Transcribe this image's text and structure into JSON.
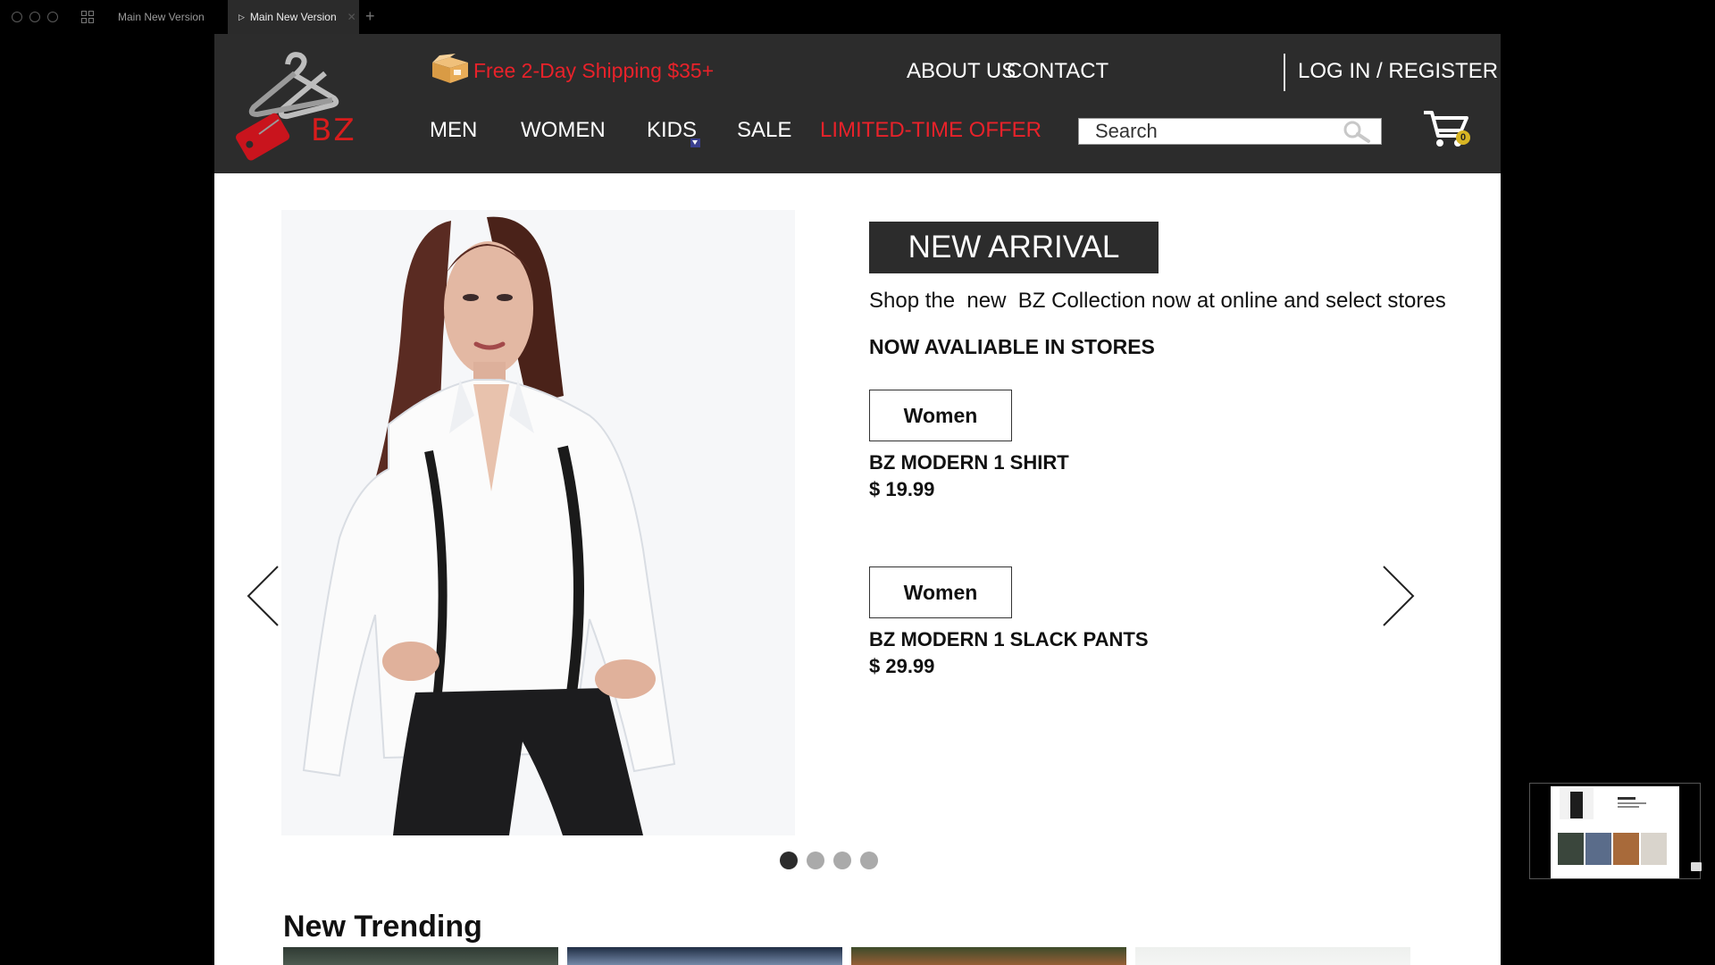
{
  "tabs": [
    {
      "label": "Main New Version"
    },
    {
      "label": "Main New Version"
    }
  ],
  "header": {
    "logo_text": "BZ",
    "shipping": "Free 2-Day Shipping $35+",
    "about": "ABOUT US",
    "contact": "CONTACT",
    "login": "LOG IN / REGISTER",
    "nav": [
      "MEN",
      "WOMEN",
      "KIDS",
      "SALE",
      "LIMITED-TIME OFFER"
    ],
    "search_placeholder": "Search",
    "cart_count": "0"
  },
  "hero": {
    "badge": "NEW ARRIVAL",
    "description": "Shop the  new  BZ Collection now at online and select stores",
    "subheading": "NOW AVALIABLE IN STORES",
    "products": [
      {
        "tag": "Women",
        "name": "BZ MODERN 1 SHIRT",
        "price": "$ 19.99"
      },
      {
        "tag": "Women",
        "name": "BZ MODERN 1 SLACK PANTS",
        "price": "$ 29.99"
      }
    ],
    "slides_total": 4,
    "active_slide": 1
  },
  "trending": {
    "title": "New Trending"
  },
  "colors": {
    "header_bg": "#2c2c2c",
    "accent_red": "#e8222a",
    "active_dot": "#2c2c2c",
    "inactive_dot": "#aaaaaa"
  }
}
